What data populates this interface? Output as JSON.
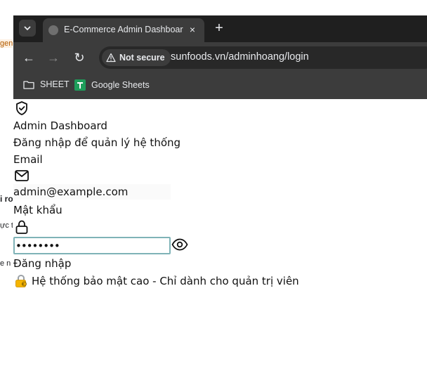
{
  "background_window": {
    "fragments": [
      "gent",
      "i ro",
      "ực tỉ",
      "e n"
    ]
  },
  "browser": {
    "tab": {
      "title": "E-Commerce Admin Dashboard",
      "close": "×"
    },
    "new_tab": "+",
    "nav": {
      "back": "←",
      "forward": "→",
      "reload": "↻"
    },
    "security_label": "Not secure",
    "url": "sunfoods.vn/adminhoang/login",
    "bookmarks": [
      {
        "label": "SHEET",
        "icon": "folder-icon"
      },
      {
        "label": "Google Sheets",
        "icon": "google-sheets-icon"
      }
    ]
  },
  "page": {
    "logo_icon": "shield-check-icon",
    "title": "Admin Dashboard",
    "subtitle": "Đăng nhập để quản lý hệ thống",
    "email_label": "Email",
    "email_value": "admin@example.com",
    "password_label": "Mật khẩu",
    "password_value": "••••••••",
    "submit_label": "Đăng nhập",
    "security_note": "Hệ thống bảo mật cao - Chỉ dành cho quản trị viên"
  },
  "colors": {
    "tabstrip": "#1f1f1f",
    "toolbar": "#3c3c3c",
    "focus_border": "#7fb3b7"
  }
}
